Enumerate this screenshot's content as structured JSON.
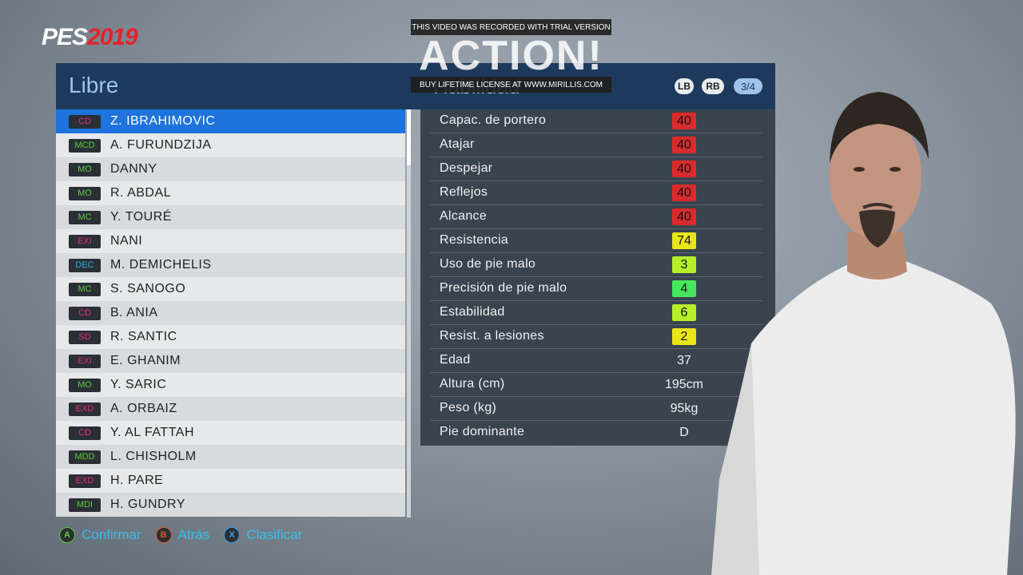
{
  "logo": {
    "prefix": "PES",
    "year": "2019"
  },
  "list_panel": {
    "title": "Libre",
    "players": [
      {
        "pos": "CD",
        "pos_color": "#e0326a",
        "name": "Z. IBRAHIMOVIC",
        "selected": true
      },
      {
        "pos": "MCD",
        "pos_color": "#5ccd3a",
        "name": "A. FURUNDZIJA"
      },
      {
        "pos": "MO",
        "pos_color": "#5ccd3a",
        "name": "DANNY"
      },
      {
        "pos": "MO",
        "pos_color": "#5ccd3a",
        "name": "R. ABDAL"
      },
      {
        "pos": "MC",
        "pos_color": "#5ccd3a",
        "name": "Y. TOURÉ"
      },
      {
        "pos": "EXI",
        "pos_color": "#e0326a",
        "name": "NANI"
      },
      {
        "pos": "DEC",
        "pos_color": "#2fb2e6",
        "name": "M. DEMICHELIS"
      },
      {
        "pos": "MC",
        "pos_color": "#5ccd3a",
        "name": "S. SANOGO"
      },
      {
        "pos": "CD",
        "pos_color": "#e0326a",
        "name": "B. ANIA"
      },
      {
        "pos": "SD",
        "pos_color": "#e0326a",
        "name": "R. SANTIC"
      },
      {
        "pos": "EXI",
        "pos_color": "#e0326a",
        "name": "E. GHANIM"
      },
      {
        "pos": "MO",
        "pos_color": "#5ccd3a",
        "name": "Y. SARIC"
      },
      {
        "pos": "EXD",
        "pos_color": "#e0326a",
        "name": "A. ORBAIZ"
      },
      {
        "pos": "CD",
        "pos_color": "#e0326a",
        "name": "Y. AL FATTAH"
      },
      {
        "pos": "MDD",
        "pos_color": "#5ccd3a",
        "name": "L. CHISHOLM"
      },
      {
        "pos": "EXD",
        "pos_color": "#e0326a",
        "name": "H. PARE"
      },
      {
        "pos": "MDI",
        "pos_color": "#5ccd3a",
        "name": "H. GUNDRY"
      }
    ]
  },
  "stats_panel": {
    "title": "Habilidad",
    "lb_label": "LB",
    "rb_label": "RB",
    "page": "3/4",
    "stats": [
      {
        "label": "Capac. de portero",
        "value": "40",
        "color": "#d92b2b"
      },
      {
        "label": "Atajar",
        "value": "40",
        "color": "#d92b2b"
      },
      {
        "label": "Despejar",
        "value": "40",
        "color": "#d92b2b"
      },
      {
        "label": "Reflejos",
        "value": "40",
        "color": "#d92b2b"
      },
      {
        "label": "Alcance",
        "value": "40",
        "color": "#d92b2b"
      },
      {
        "label": "Resistencia",
        "value": "74",
        "color": "#e8e51a"
      },
      {
        "label": "Uso de pie malo",
        "value": "3",
        "color": "#b6ee2a"
      },
      {
        "label": "Precisión de pie malo",
        "value": "4",
        "color": "#45e85c"
      },
      {
        "label": "Estabilidad",
        "value": "6",
        "color": "#b6ee2a"
      },
      {
        "label": "Resist. a lesiones",
        "value": "2",
        "color": "#e8e51a"
      },
      {
        "label": "Edad",
        "value": "37",
        "color": ""
      },
      {
        "label": "Altura (cm)",
        "value": "195cm",
        "color": ""
      },
      {
        "label": "Peso (kg)",
        "value": "95kg",
        "color": ""
      },
      {
        "label": "Pie dominante",
        "value": "D",
        "color": ""
      }
    ]
  },
  "watermark": {
    "top": "THIS VIDEO WAS RECORDED WITH TRIAL VERSION",
    "big": "ACTION!",
    "bottom": "BUY LIFETIME LICENSE AT WWW.MIRILLIS.COM"
  },
  "help_bar": [
    {
      "key": "A",
      "key_color": "#5ccd3a",
      "label": "Confirmar"
    },
    {
      "key": "B",
      "key_color": "#e0532d",
      "label": "Atrás"
    },
    {
      "key": "X",
      "key_color": "#3aa0e6",
      "label": "Clasificar"
    }
  ]
}
